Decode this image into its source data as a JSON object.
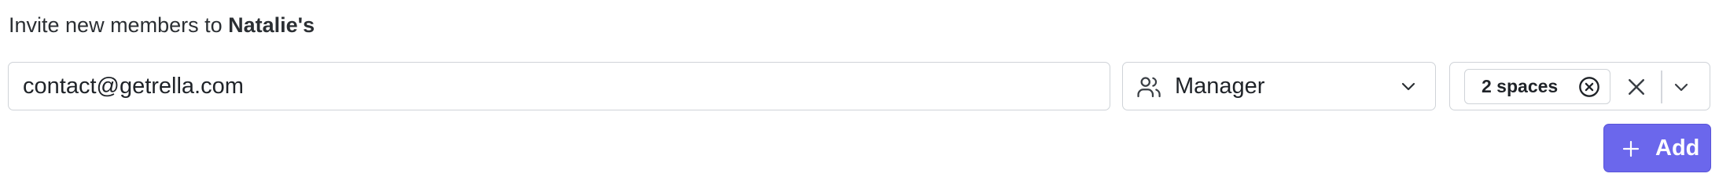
{
  "heading": {
    "prefix": "Invite new members to ",
    "org_name": "Natalie's"
  },
  "invite_form": {
    "email": {
      "value": "contact@getrella.com"
    },
    "role": {
      "selected": "Manager",
      "icon": "users-icon"
    },
    "spaces": {
      "chip_label": "2 spaces"
    },
    "add_button": {
      "label": "Add"
    }
  },
  "colors": {
    "accent": "#6b67ec",
    "border": "#cfd3d8",
    "text": "#1f2328"
  }
}
